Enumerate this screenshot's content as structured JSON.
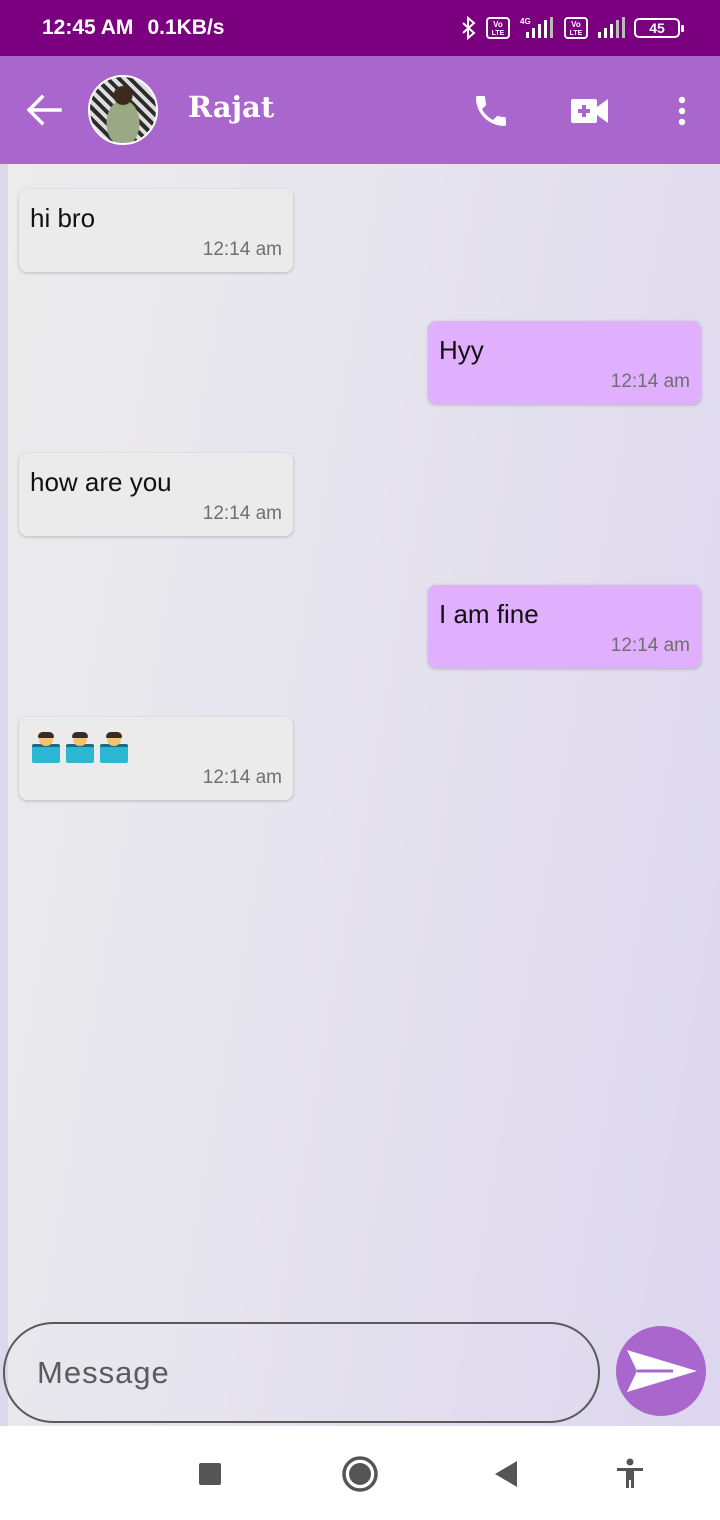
{
  "status_bar": {
    "time": "12:45 AM",
    "speed": "0.1KB/s",
    "network_label": "4G",
    "volte_1": "Vo LTE",
    "volte_2": "Vo LTE",
    "battery": "45"
  },
  "header": {
    "contact_name": "Rajat",
    "accent_color": "#a966cc"
  },
  "messages": [
    {
      "direction": "in",
      "text": "hi bro",
      "time": "12:14 am"
    },
    {
      "direction": "out",
      "text": "Hyy",
      "time": "12:14 am"
    },
    {
      "direction": "in",
      "text": "how are you",
      "time": "12:14 am"
    },
    {
      "direction": "out",
      "text": "I am fine",
      "time": "12:14 am"
    },
    {
      "direction": "in",
      "text": "🧑‍💻🧑‍💻🧑‍💻",
      "time": "12:14 am"
    }
  ],
  "composer": {
    "placeholder": "Message"
  },
  "icons": {
    "back": "arrow-left-icon",
    "call": "phone-icon",
    "video": "video-camera-icon",
    "more": "more-vertical-icon",
    "send": "send-icon",
    "nav_recent": "square-icon",
    "nav_home": "circle-icon",
    "nav_back": "triangle-back-icon",
    "nav_accessibility": "accessibility-icon"
  }
}
